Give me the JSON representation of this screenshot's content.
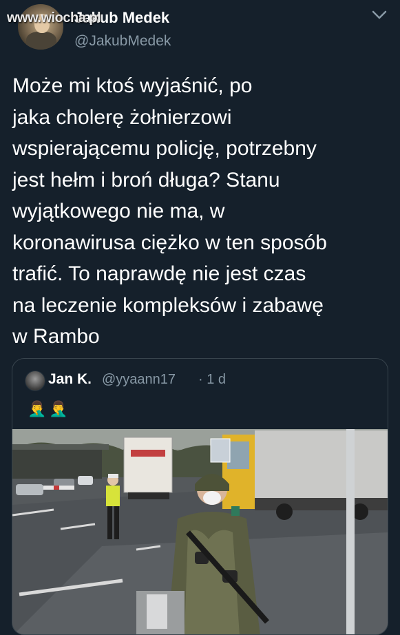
{
  "watermark": "www.wiocha.pl",
  "author": {
    "display_name": "Jakub Medek",
    "handle": "@JakubMedek",
    "avatar_icon": "user-avatar"
  },
  "tweet": {
    "lines": [
      "Może mi ktoś wyjaśnić, po",
      "jaka cholerę żołnierzowi",
      "wspierającemu policję, potrzebny",
      "jest hełm i broń długa? Stanu",
      "wyjątkowego nie ma, w",
      "koronawirusa ciężko w ten sposób",
      "trafić. To naprawdę nie jest czas",
      "na leczenie kompleksów i zabawę",
      "w Rambo"
    ]
  },
  "quoted_tweet": {
    "display_name": "Jan K.",
    "handle": "@yyaann17",
    "time": "· 1 d",
    "emoji": "🤦‍♂️🤦‍♂️",
    "image_icon": "photo-soldier-checkpoint"
  },
  "colors": {
    "background": "#15202b",
    "text": "#ffffff",
    "secondary_text": "#8899a6",
    "border": "#38444d"
  }
}
